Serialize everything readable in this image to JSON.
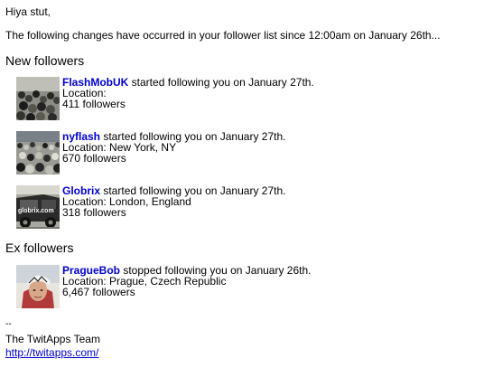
{
  "greeting": "Hiya stut,",
  "intro": "The following changes have occurred in your follower list since 12:00am on January 26th...",
  "new_followers": {
    "heading": "New followers",
    "entries": [
      {
        "name": "FlashMobUK",
        "action": " started following you on January 27th.",
        "location": "Location:",
        "followers": "411 followers"
      },
      {
        "name": "nyflash",
        "action": " started following you on January 27th.",
        "location": "Location: New York, NY",
        "followers": "670 followers"
      },
      {
        "name": "Globrix",
        "action": " started following you on January 27th.",
        "location": "Location: London, England",
        "followers": "318 followers"
      }
    ]
  },
  "ex_followers": {
    "heading": "Ex followers",
    "entries": [
      {
        "name": "PragueBob",
        "action": " stopped following you on January 26th.",
        "location": "Location: Prague, Czech Republic",
        "followers": "6,467 followers"
      }
    ]
  },
  "signature": {
    "separator": "--",
    "team": "The TwitApps Team",
    "url": "http://twitapps.com/"
  },
  "thumb_text": {
    "globrix": "globrix.com"
  }
}
